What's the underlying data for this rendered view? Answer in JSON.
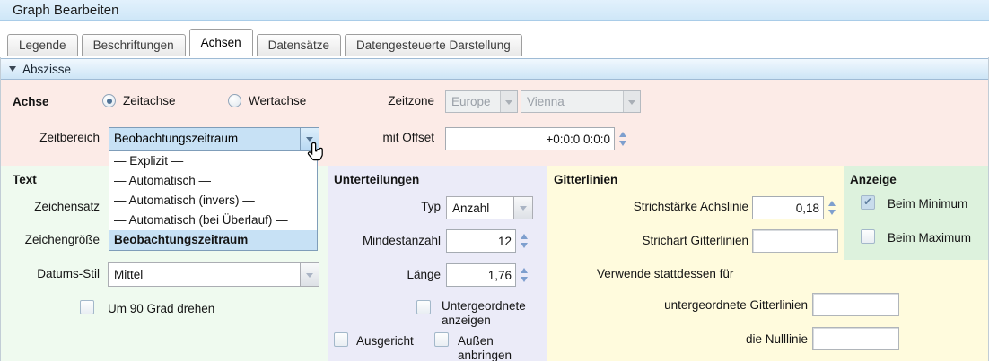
{
  "window": {
    "title": "Graph Bearbeiten"
  },
  "tabs": {
    "items": [
      {
        "label": "Legende",
        "active": false
      },
      {
        "label": "Beschriftungen",
        "active": false
      },
      {
        "label": "Achsen",
        "active": true
      },
      {
        "label": "Datensätze",
        "active": false
      },
      {
        "label": "Datengesteuerte Darstellung",
        "active": false
      }
    ]
  },
  "abszisse": {
    "label": "Abszisse"
  },
  "achse": {
    "label": "Achse",
    "zeitachse_label": "Zeitachse",
    "wertachse_label": "Wertachse",
    "zeitzone_label": "Zeitzone",
    "zeitzone_region": "Europe",
    "zeitzone_city": "Vienna",
    "zeitbereich_label": "Zeitbereich",
    "zeitbereich_value": "Beobachtungszeitraum",
    "offset_label": "mit Offset",
    "offset_value": "+0:0:0 0:0:0"
  },
  "zeitbereich_dropdown": {
    "options": [
      "— Explizit —",
      "— Automatisch —",
      "— Automatisch (invers) —",
      "— Automatisch (bei Überlauf) —",
      "Beobachtungszeitraum"
    ],
    "selected": "Beobachtungszeitraum"
  },
  "text_section": {
    "title": "Text",
    "zeichensatz_label": "Zeichensatz",
    "zeichengroesse_label": "Zeichengröße",
    "datums_stil_label": "Datums-Stil",
    "datums_stil_value": "Mittel",
    "rotate_label": "Um 90 Grad drehen"
  },
  "unterteilungen": {
    "title": "Unterteilungen",
    "typ_label": "Typ",
    "typ_value": "Anzahl",
    "mindestanzahl_label": "Mindestanzahl",
    "mindestanzahl_value": "12",
    "laenge_label": "Länge",
    "laenge_value": "1,76",
    "untergeordnete_label": "Untergeordnete anzeigen",
    "ausgerichtet_label": "Ausgericht",
    "aussen_label": "Außen anbringen"
  },
  "gitterlinien": {
    "title": "Gitterlinien",
    "strichstaerke_label": "Strichstärke Achslinie",
    "strichstaerke_value": "0,18",
    "strichart_label": "Strichart Gitterlinien",
    "strichart_value": "",
    "verwende_label": "Verwende stattdessen für",
    "untergeordnete_label": "untergeordnete Gitterlinien",
    "untergeordnete_value": "",
    "nulllinie_label": "die Nulllinie",
    "nulllinie_value": ""
  },
  "anzeige": {
    "title": "Anzeige",
    "minimum_label": "Beim Minimum",
    "maximum_label": "Beim Maximum"
  },
  "colors": {
    "header_blue": "#d9edfa",
    "section_pink": "#fcebe7",
    "section_green": "#effaef",
    "section_lavender": "#ebebf8",
    "section_yellow": "#fffbdd",
    "anzeige_green": "#ddf2dd",
    "highlight_blue": "#c7e1f5"
  }
}
